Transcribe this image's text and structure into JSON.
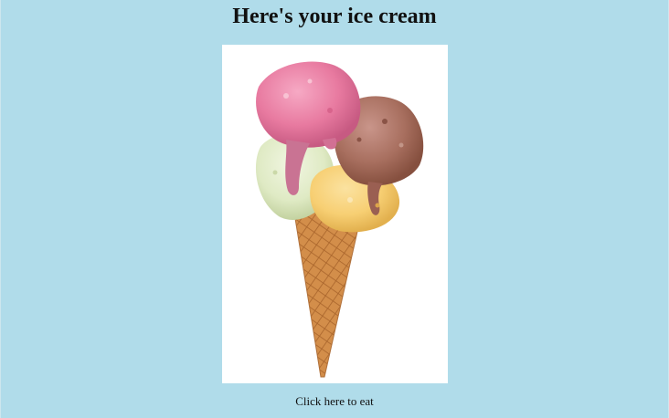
{
  "page": {
    "title": "Here's your ice cream",
    "background_color": "#b0dcea"
  },
  "image": {
    "icon": "ice-cream-cone",
    "scoop_colors": {
      "strawberry": "#e87aa0",
      "chocolate": "#a86f5f",
      "pistachio": "#dfeac4",
      "vanilla": "#f7cf73"
    },
    "cone_color": "#d38e4a"
  },
  "action": {
    "label": "Click here to eat"
  }
}
